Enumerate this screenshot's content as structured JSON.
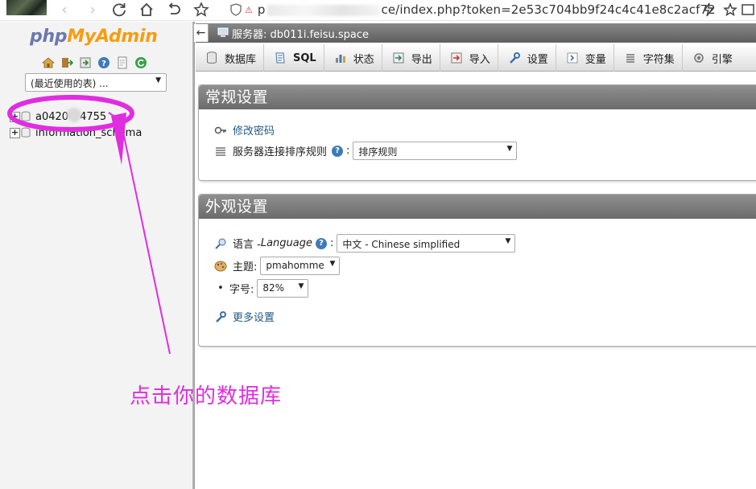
{
  "browser": {
    "url_prefix": "p",
    "url_suffix": "ce/index.php?token=2e53c704bb9f24c4c41e8c2acf72"
  },
  "nav": {
    "logo_php": "php",
    "logo_my": "My",
    "logo_admin": "Admin",
    "recent_select": "(最近使用的表) ...",
    "databases": [
      {
        "name_start": "a0420",
        "name_end": "4755"
      },
      {
        "name": "information_schema"
      }
    ]
  },
  "server": {
    "label": "服务器: db011i.feisu.space"
  },
  "tabs": [
    {
      "label": "数据库",
      "icon": "database-icon"
    },
    {
      "label": "SQL",
      "icon": "sql-icon"
    },
    {
      "label": "状态",
      "icon": "status-icon"
    },
    {
      "label": "导出",
      "icon": "export-icon"
    },
    {
      "label": "导入",
      "icon": "import-icon"
    },
    {
      "label": "设置",
      "icon": "wrench-icon"
    },
    {
      "label": "变量",
      "icon": "variables-icon"
    },
    {
      "label": "字符集",
      "icon": "charset-icon"
    },
    {
      "label": "引擎",
      "icon": "engine-icon"
    }
  ],
  "general": {
    "title": "常规设置",
    "change_password": "修改密码",
    "collation_label": "服务器连接排序规则",
    "collation_value": "排序规则"
  },
  "appearance": {
    "title": "外观设置",
    "language_label": "语言 - ",
    "language_en": "Language",
    "language_value": "中文 - Chinese simplified",
    "theme_label": "主题:",
    "theme_value": "pmahomme",
    "fontsize_label": "字号:",
    "fontsize_value": "82%",
    "more_settings": "更多设置"
  },
  "annotation": {
    "text": "点击你的数据库",
    "color": "#e02de0"
  }
}
